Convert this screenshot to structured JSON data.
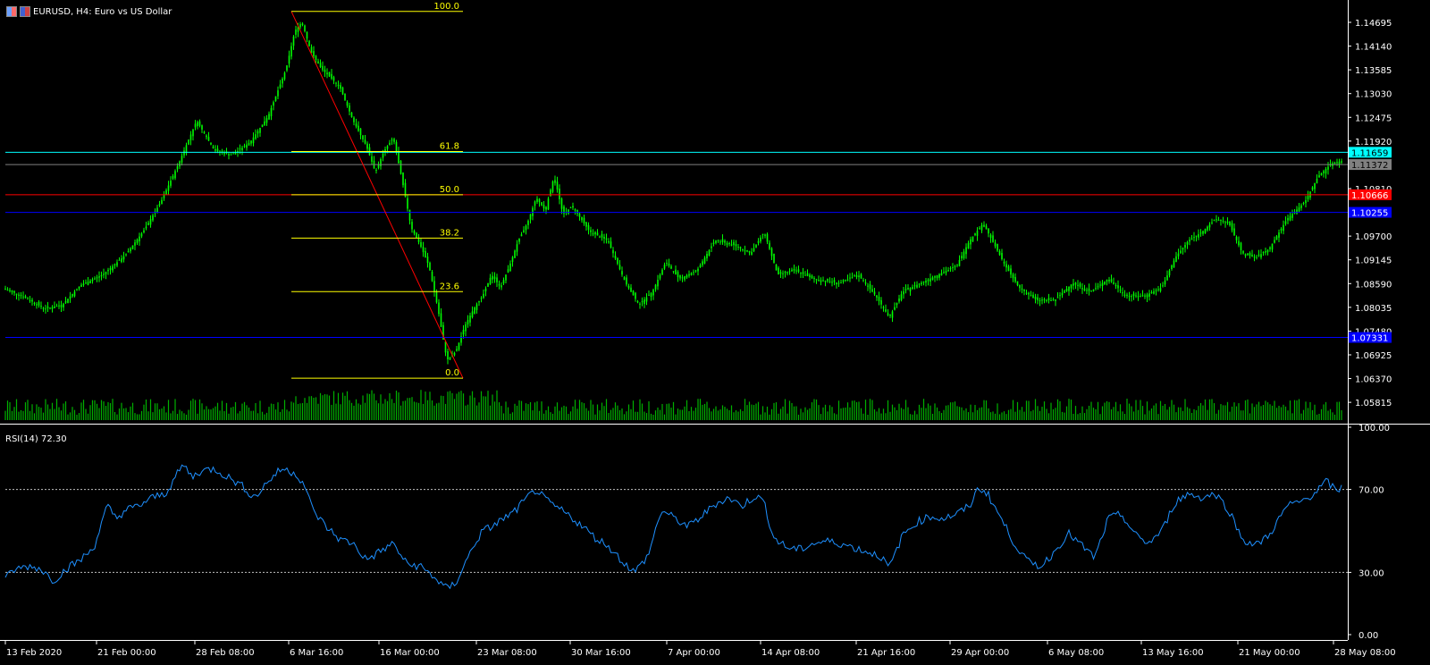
{
  "window": {
    "symbol": "EURUSD, H4:",
    "description": "Euro vs US Dollar",
    "icons": [
      "chart-window-icon",
      "symbol-flag-icon"
    ]
  },
  "price_axis": {
    "labels": [
      "1.14695",
      "1.14140",
      "1.13585",
      "1.13030",
      "1.12475",
      "1.11920",
      "1.10810",
      "1.09700",
      "1.09145",
      "1.08590",
      "1.08035",
      "1.07480",
      "1.06925",
      "1.06370",
      "1.05815"
    ],
    "range": [
      1.054,
      1.1505
    ]
  },
  "price_tags": [
    {
      "label": "1.11659",
      "value": 1.11659,
      "color": "#00ffff",
      "text_color": "#000000"
    },
    {
      "label": "1.11372",
      "value": 1.11372,
      "color": "#808080",
      "text_color": "#000000"
    },
    {
      "label": "1.10666",
      "value": 1.10666,
      "color": "#ff0000",
      "text_color": "#ffffff"
    },
    {
      "label": "1.10255",
      "value": 1.10255,
      "color": "#0000ff",
      "text_color": "#ffffff"
    },
    {
      "label": "1.07331",
      "value": 1.07331,
      "color": "#0000ff",
      "text_color": "#ffffff"
    }
  ],
  "fibonacci": {
    "color": "#ffff00",
    "trend_color": "#ff0000",
    "high": 1.1495,
    "low": 1.0638,
    "levels": [
      {
        "label": "100.0",
        "ratio": 1.0
      },
      {
        "label": "61.8",
        "ratio": 0.618
      },
      {
        "label": "50.0",
        "ratio": 0.5
      },
      {
        "label": "38.2",
        "ratio": 0.382
      },
      {
        "label": "23.6",
        "ratio": 0.236
      },
      {
        "label": "0.0",
        "ratio": 0.0
      }
    ]
  },
  "time_axis": {
    "labels": [
      "13 Feb 2020",
      "21 Feb 00:00",
      "28 Feb 08:00",
      "6 Mar 16:00",
      "16 Mar 00:00",
      "23 Mar 08:00",
      "30 Mar 16:00",
      "7 Apr 00:00",
      "14 Apr 08:00",
      "21 Apr 16:00",
      "29 Apr 00:00",
      "6 May 08:00",
      "13 May 16:00",
      "21 May 00:00",
      "28 May 08:00"
    ]
  },
  "rsi": {
    "title": "RSI(14) 72.30",
    "axis_labels": [
      "100.00",
      "70.00",
      "30.00",
      "0.00"
    ],
    "levels": [
      70,
      30
    ],
    "color": "#1e90ff"
  },
  "colors": {
    "candle": "#00ff00",
    "volume": "#00b000",
    "background": "#000000",
    "axis": "#ffffff"
  },
  "chart_data": {
    "type": "candlestick",
    "title": "EURUSD, H4: Euro vs US Dollar",
    "anchors_close": [
      [
        0,
        1.085
      ],
      [
        25,
        1.083
      ],
      [
        50,
        1.08
      ],
      [
        70,
        1.081
      ],
      [
        90,
        1.0855
      ],
      [
        115,
        1.088
      ],
      [
        140,
        1.0925
      ],
      [
        160,
        1.098
      ],
      [
        180,
        1.105
      ],
      [
        200,
        1.114
      ],
      [
        220,
        1.124
      ],
      [
        240,
        1.117
      ],
      [
        260,
        1.116
      ],
      [
        280,
        1.119
      ],
      [
        300,
        1.125
      ],
      [
        320,
        1.136
      ],
      [
        330,
        1.145
      ],
      [
        338,
        1.147
      ],
      [
        348,
        1.14
      ],
      [
        360,
        1.136
      ],
      [
        380,
        1.132
      ],
      [
        395,
        1.124
      ],
      [
        410,
        1.118
      ],
      [
        420,
        1.112
      ],
      [
        430,
        1.117
      ],
      [
        440,
        1.12
      ],
      [
        450,
        1.11
      ],
      [
        460,
        1.099
      ],
      [
        470,
        1.095
      ],
      [
        480,
        1.09
      ],
      [
        490,
        1.08
      ],
      [
        500,
        1.068
      ],
      [
        510,
        1.07
      ],
      [
        520,
        1.076
      ],
      [
        530,
        1.08
      ],
      [
        540,
        1.083
      ],
      [
        550,
        1.088
      ],
      [
        560,
        1.085
      ],
      [
        570,
        1.09
      ],
      [
        580,
        1.096
      ],
      [
        590,
        1.1
      ],
      [
        600,
        1.106
      ],
      [
        610,
        1.103
      ],
      [
        620,
        1.111
      ],
      [
        630,
        1.102
      ],
      [
        640,
        1.104
      ],
      [
        660,
        1.098
      ],
      [
        680,
        1.096
      ],
      [
        700,
        1.086
      ],
      [
        715,
        1.081
      ],
      [
        730,
        1.084
      ],
      [
        745,
        1.091
      ],
      [
        760,
        1.087
      ],
      [
        780,
        1.089
      ],
      [
        800,
        1.096
      ],
      [
        820,
        1.095
      ],
      [
        840,
        1.093
      ],
      [
        855,
        1.098
      ],
      [
        870,
        1.088
      ],
      [
        890,
        1.089
      ],
      [
        910,
        1.087
      ],
      [
        940,
        1.086
      ],
      [
        960,
        1.088
      ],
      [
        980,
        1.083
      ],
      [
        995,
        1.078
      ],
      [
        1010,
        1.084
      ],
      [
        1030,
        1.086
      ],
      [
        1050,
        1.088
      ],
      [
        1070,
        1.09
      ],
      [
        1085,
        1.096
      ],
      [
        1100,
        1.1
      ],
      [
        1110,
        1.096
      ],
      [
        1125,
        1.09
      ],
      [
        1140,
        1.085
      ],
      [
        1160,
        1.082
      ],
      [
        1180,
        1.082
      ],
      [
        1200,
        1.086
      ],
      [
        1220,
        1.084
      ],
      [
        1240,
        1.087
      ],
      [
        1260,
        1.083
      ],
      [
        1280,
        1.083
      ],
      [
        1300,
        1.085
      ],
      [
        1315,
        1.092
      ],
      [
        1330,
        1.096
      ],
      [
        1345,
        1.098
      ],
      [
        1360,
        1.101
      ],
      [
        1375,
        1.1
      ],
      [
        1390,
        1.093
      ],
      [
        1405,
        1.092
      ],
      [
        1420,
        1.094
      ],
      [
        1440,
        1.101
      ],
      [
        1460,
        1.105
      ],
      [
        1475,
        1.111
      ],
      [
        1490,
        1.114
      ],
      [
        1500,
        1.1145
      ]
    ],
    "rsi_anchors": [
      [
        0,
        24
      ],
      [
        15,
        31
      ],
      [
        30,
        33
      ],
      [
        45,
        32
      ],
      [
        60,
        26
      ],
      [
        75,
        32
      ],
      [
        90,
        36
      ],
      [
        105,
        42
      ],
      [
        120,
        62
      ],
      [
        130,
        56
      ],
      [
        140,
        60
      ],
      [
        155,
        62
      ],
      [
        170,
        66
      ],
      [
        185,
        68
      ],
      [
        195,
        75
      ],
      [
        205,
        82
      ],
      [
        215,
        76
      ],
      [
        225,
        79
      ],
      [
        240,
        80
      ],
      [
        255,
        76
      ],
      [
        270,
        72
      ],
      [
        285,
        66
      ],
      [
        300,
        74
      ],
      [
        315,
        80
      ],
      [
        330,
        78
      ],
      [
        340,
        73
      ],
      [
        350,
        60
      ],
      [
        365,
        52
      ],
      [
        380,
        46
      ],
      [
        395,
        44
      ],
      [
        410,
        36
      ],
      [
        425,
        40
      ],
      [
        440,
        44
      ],
      [
        455,
        34
      ],
      [
        470,
        33
      ],
      [
        485,
        28
      ],
      [
        500,
        22
      ],
      [
        510,
        25
      ],
      [
        520,
        34
      ],
      [
        530,
        43
      ],
      [
        540,
        50
      ],
      [
        550,
        52
      ],
      [
        560,
        55
      ],
      [
        575,
        59
      ],
      [
        590,
        66
      ],
      [
        600,
        70
      ],
      [
        610,
        65
      ],
      [
        620,
        62
      ],
      [
        635,
        58
      ],
      [
        650,
        53
      ],
      [
        665,
        47
      ],
      [
        680,
        43
      ],
      [
        695,
        36
      ],
      [
        710,
        30
      ],
      [
        725,
        38
      ],
      [
        740,
        60
      ],
      [
        755,
        56
      ],
      [
        770,
        52
      ],
      [
        785,
        57
      ],
      [
        800,
        63
      ],
      [
        815,
        66
      ],
      [
        830,
        62
      ],
      [
        845,
        67
      ],
      [
        855,
        64
      ],
      [
        865,
        47
      ],
      [
        880,
        42
      ],
      [
        895,
        41
      ],
      [
        910,
        44
      ],
      [
        925,
        45
      ],
      [
        940,
        44
      ],
      [
        955,
        42
      ],
      [
        970,
        40
      ],
      [
        985,
        38
      ],
      [
        995,
        32
      ],
      [
        1010,
        48
      ],
      [
        1025,
        54
      ],
      [
        1040,
        57
      ],
      [
        1055,
        56
      ],
      [
        1070,
        58
      ],
      [
        1085,
        62
      ],
      [
        1095,
        71
      ],
      [
        1105,
        68
      ],
      [
        1115,
        60
      ],
      [
        1125,
        52
      ],
      [
        1135,
        44
      ],
      [
        1150,
        35
      ],
      [
        1165,
        33
      ],
      [
        1180,
        40
      ],
      [
        1195,
        49
      ],
      [
        1210,
        43
      ],
      [
        1225,
        37
      ],
      [
        1240,
        56
      ],
      [
        1255,
        58
      ],
      [
        1270,
        48
      ],
      [
        1285,
        44
      ],
      [
        1300,
        50
      ],
      [
        1315,
        64
      ],
      [
        1330,
        68
      ],
      [
        1345,
        66
      ],
      [
        1360,
        68
      ],
      [
        1375,
        60
      ],
      [
        1390,
        46
      ],
      [
        1405,
        43
      ],
      [
        1420,
        48
      ],
      [
        1440,
        62
      ],
      [
        1455,
        64
      ],
      [
        1470,
        68
      ],
      [
        1485,
        74
      ],
      [
        1495,
        69
      ],
      [
        1505,
        72
      ]
    ],
    "ylim": [
      1.054,
      1.1505
    ],
    "rsi_ylim": [
      0,
      100
    ]
  }
}
